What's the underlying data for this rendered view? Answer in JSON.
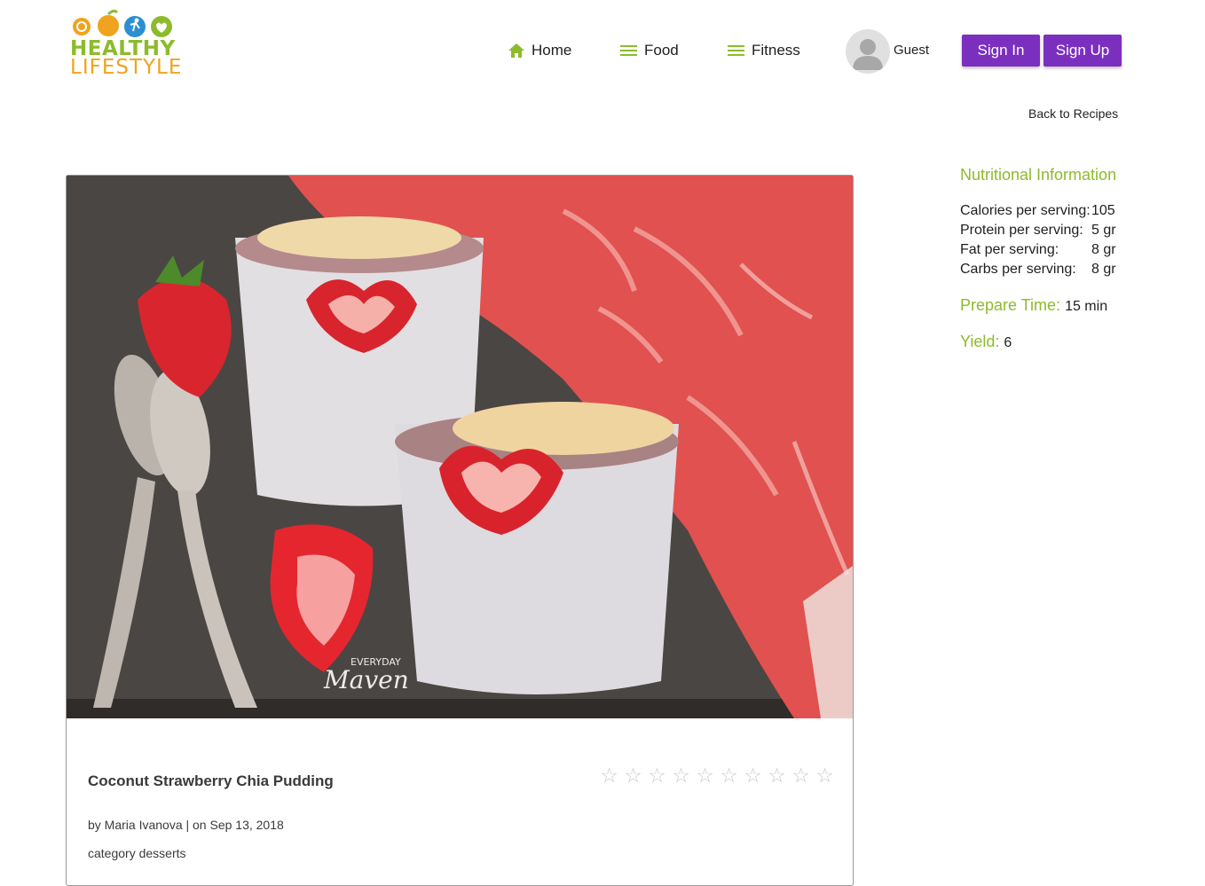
{
  "brand": {
    "line1": "HEALTHY",
    "line2": "LIFESTYLE",
    "green": "#8dbb2c",
    "orange": "#f0a31e"
  },
  "nav": {
    "home": {
      "label": "Home",
      "icon": "home-icon"
    },
    "food": {
      "label": "Food",
      "icon": "menu-icon"
    },
    "fitness": {
      "label": "Fitness",
      "icon": "menu-icon"
    }
  },
  "user": {
    "name": "Guest",
    "avatar": "avatar-placeholder"
  },
  "auth": {
    "sign_in": "Sign In",
    "sign_up": "Sign Up",
    "accent": "#7b2fbf"
  },
  "back_link": "Back to Recipes",
  "recipe": {
    "title": "Coconut Strawberry Chia Pudding",
    "byline": "by Maria Ivanova | on Sep 13, 2018",
    "category": "category desserts",
    "rating": {
      "max": 10,
      "value": 0,
      "star_glyph": "☆"
    },
    "image_watermark": {
      "line1": "EVERYDAY",
      "line2": "Maven"
    }
  },
  "nutrition": {
    "heading": "Nutritional Information",
    "rows": [
      {
        "label": "Calories per serving:",
        "value": "105"
      },
      {
        "label": "Protein per serving:",
        "value": "5 gr"
      },
      {
        "label": "Fat per serving:",
        "value": "8 gr"
      },
      {
        "label": "Carbs per serving:",
        "value": "8 gr"
      }
    ],
    "prepare_label": "Prepare Time:",
    "prepare_value": "15 min",
    "yield_label": "Yield:",
    "yield_value": "6"
  }
}
